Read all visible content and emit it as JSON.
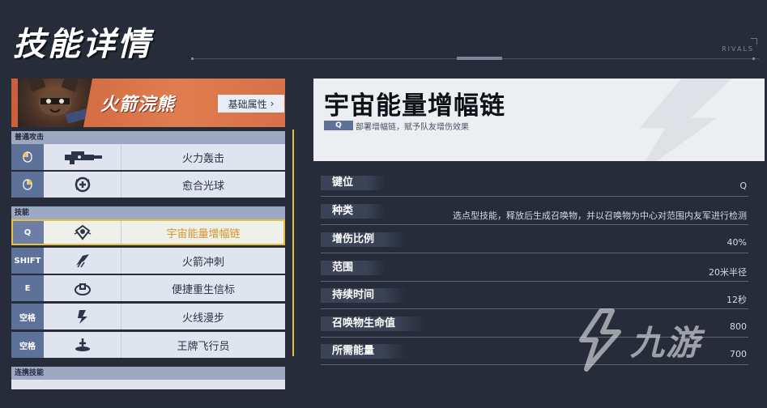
{
  "header": {
    "title": "技能详情",
    "brand": "RIVALS"
  },
  "hero": {
    "name": "火箭浣熊",
    "attr_button": "基础属性",
    "attr_button_arrow": "›"
  },
  "sections": {
    "normal_attack": "普通攻击",
    "skills": "技能",
    "team_up": "连携技能"
  },
  "skills": [
    {
      "key": "",
      "icon": "blaster-icon",
      "name": "火力轰击"
    },
    {
      "key": "",
      "icon": "orb-icon",
      "name": "愈合光球"
    },
    {
      "key": "Q",
      "icon": "amplifier-icon",
      "name": "宇宙能量增幅链"
    },
    {
      "key": "SHIFT",
      "icon": "rocket-wings-icon",
      "name": "火箭冲刺"
    },
    {
      "key": "E",
      "icon": "beacon-icon",
      "name": "便捷重生信标"
    },
    {
      "key": "空格",
      "icon": "jet-icon",
      "name": "火线漫步"
    },
    {
      "key": "空格",
      "icon": "pilot-icon",
      "name": "王牌飞行员"
    }
  ],
  "detail": {
    "title": "宇宙能量增幅链",
    "key": "Q",
    "description": "部署增幅链，赋予队友增伤效果",
    "attributes": [
      {
        "label": "键位",
        "value": "Q"
      },
      {
        "label": "种类",
        "value": "选点型技能，释放后生成召唤物，并以召唤物为中心对范围内友军进行检测"
      },
      {
        "label": "增伤比例",
        "value": "40%"
      },
      {
        "label": "范围",
        "value": "20米半径"
      },
      {
        "label": "持续时间",
        "value": "12秒"
      },
      {
        "label": "召唤物生命值",
        "value": "800"
      },
      {
        "label": "所需能量",
        "value": "700"
      }
    ]
  },
  "watermark": {
    "text": "九游"
  },
  "colors": {
    "background": "#262c3a",
    "hero_banner": "#e07d4f",
    "selected_outline": "#e8c13c",
    "selected_text": "#d7932b",
    "key_badge": "#5e7299"
  }
}
